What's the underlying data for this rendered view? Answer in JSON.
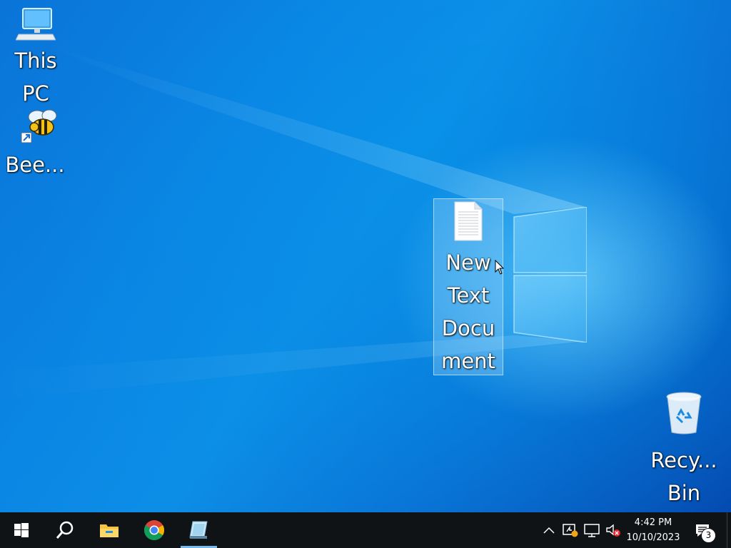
{
  "desktop": {
    "icons": [
      {
        "label": "This PC",
        "icon": "computer-icon"
      },
      {
        "label": "Bee...",
        "icon": "bee-icon"
      },
      {
        "label": "New Text Document",
        "icon": "text-document-icon",
        "selected": true
      },
      {
        "label": "Recy... Bin",
        "icon": "recycle-bin-icon"
      }
    ]
  },
  "taskbar": {
    "buttons": [
      {
        "name": "start",
        "icon": "windows-start-icon"
      },
      {
        "name": "search",
        "icon": "search-icon"
      },
      {
        "name": "file-explorer",
        "icon": "folder-icon"
      },
      {
        "name": "chrome",
        "icon": "chrome-icon"
      },
      {
        "name": "active-app",
        "icon": "notepad-app-icon",
        "active": true
      }
    ],
    "tray": {
      "icons": [
        "chevron-up-icon",
        "network-warning-icon",
        "monitor-icon",
        "volume-muted-icon"
      ],
      "time": "4:42 PM",
      "date": "10/10/2023",
      "notification_count": "3"
    }
  },
  "colors": {
    "taskbar": "#101316",
    "accent": "#76b9ed",
    "wallpaper": "#0a86e4"
  }
}
